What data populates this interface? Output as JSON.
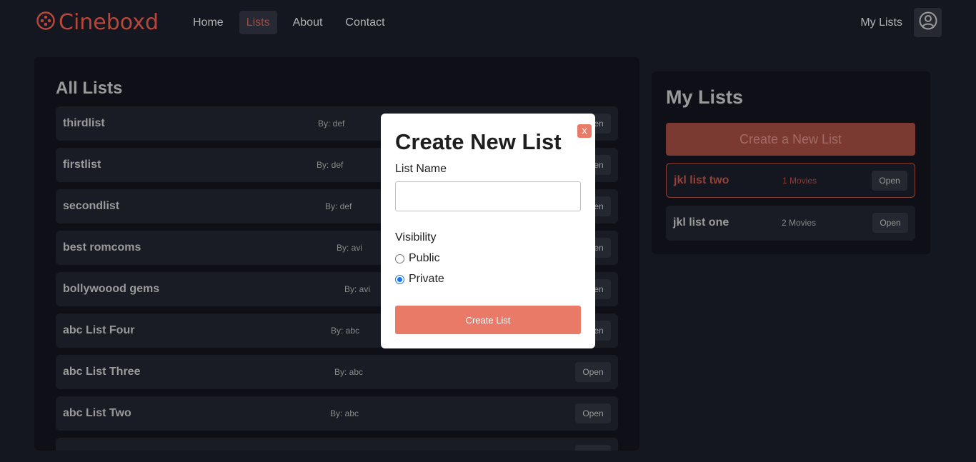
{
  "nav": {
    "brand": "Cineboxd",
    "links": [
      {
        "label": "Home",
        "active": false
      },
      {
        "label": "Lists",
        "active": true
      },
      {
        "label": "About",
        "active": false
      },
      {
        "label": "Contact",
        "active": false
      }
    ],
    "my_lists_label": "My Lists"
  },
  "all_lists": {
    "title": "All Lists",
    "open_label": "Open",
    "rows": [
      {
        "name": "thirdlist",
        "by": "By: def"
      },
      {
        "name": "firstlist",
        "by": "By: def"
      },
      {
        "name": "secondlist",
        "by": "By: def"
      },
      {
        "name": "best romcoms",
        "by": "By: avi"
      },
      {
        "name": "bollywoood gems",
        "by": "By: avi"
      },
      {
        "name": "abc List Four",
        "by": "By: abc"
      },
      {
        "name": "abc List Three",
        "by": "By: abc"
      },
      {
        "name": "abc List Two",
        "by": "By: abc"
      }
    ]
  },
  "my_lists": {
    "title": "My Lists",
    "create_label": "Create a New List",
    "open_label": "Open",
    "rows": [
      {
        "name": "jkl list two",
        "count": "1 Movies"
      },
      {
        "name": "jkl list one",
        "count": "2 Movies"
      }
    ]
  },
  "modal": {
    "close_label": "X",
    "title": "Create New List",
    "list_name_label": "List Name",
    "list_name_value": "",
    "visibility_label": "Visibility",
    "public_label": "Public",
    "private_label": "Private",
    "selected_visibility": "Private",
    "create_label": "Create List"
  },
  "colors": {
    "accent": "#e97a68",
    "brand": "#b5483a",
    "background": "#141620"
  }
}
